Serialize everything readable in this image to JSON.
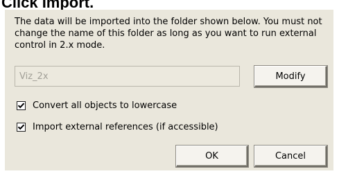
{
  "caption": "Click Import.",
  "dialog": {
    "description": "The data will be imported into the folder shown below. You must not change the name of this folder as long as you want to run external control in 2.x mode.",
    "folder_field": {
      "value": "Viz_2x",
      "enabled": false
    },
    "modify_label": "Modify",
    "options": [
      {
        "label": "Convert all objects to lowercase",
        "checked": true
      },
      {
        "label": "Import external references (if accessible)",
        "checked": true
      }
    ],
    "ok_label": "OK",
    "cancel_label": "Cancel"
  }
}
